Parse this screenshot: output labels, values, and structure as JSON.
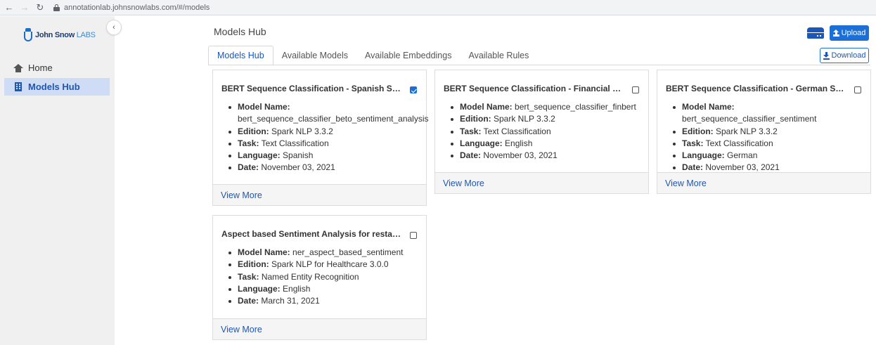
{
  "browser": {
    "url": "annotationlab.johnsnowlabs.com/#/models"
  },
  "sidebar": {
    "logo_brand": "John Snow",
    "logo_labs": "LABS",
    "items": [
      {
        "label": "Home",
        "icon": "home-icon"
      },
      {
        "label": "Models Hub",
        "icon": "building-icon",
        "active": true
      }
    ]
  },
  "header": {
    "title": "Models Hub",
    "upload_label": "Upload",
    "download_label": "Download"
  },
  "tabs": [
    {
      "label": "Models Hub",
      "active": true
    },
    {
      "label": "Available Models"
    },
    {
      "label": "Available Embeddings"
    },
    {
      "label": "Available Rules"
    }
  ],
  "cards": [
    {
      "title": "BERT Sequence Classification - Spanish Sentiment Analysis",
      "checked": true,
      "model_name": "bert_sequence_classifier_beto_sentiment_analysis",
      "edition": "Spark NLP 3.3.2",
      "task": "Text Classification",
      "language": "Spanish",
      "date": "November 03, 2021",
      "view_more": "View More"
    },
    {
      "title": "BERT Sequence Classification - Financial Sentiment Analysis",
      "checked": false,
      "model_name": "bert_sequence_classifier_finbert",
      "edition": "Spark NLP 3.3.2",
      "task": "Text Classification",
      "language": "English",
      "date": "November 03, 2021",
      "view_more": "View More"
    },
    {
      "title": "BERT Sequence Classification - German Sentiment Analysis",
      "checked": false,
      "model_name": "bert_sequence_classifier_sentiment",
      "edition": "Spark NLP 3.3.2",
      "task": "Text Classification",
      "language": "German",
      "date": "November 03, 2021",
      "view_more": "View More"
    },
    {
      "title": "Aspect based Sentiment Analysis for restaurant reviews",
      "checked": false,
      "model_name": "ner_aspect_based_sentiment",
      "edition": "Spark NLP for Healthcare 3.0.0",
      "task": "Named Entity Recognition",
      "language": "English",
      "date": "March 31, 2021",
      "view_more": "View More"
    }
  ],
  "field_labels": {
    "model_name": "Model Name:",
    "edition": "Edition:",
    "task": "Task:",
    "language": "Language:",
    "date": "Date:"
  },
  "colors": {
    "accent": "#1c6fd6",
    "link": "#1c57b5",
    "sidebar_bg": "#f0f0f0",
    "active_item_bg": "#cfdcf5"
  }
}
